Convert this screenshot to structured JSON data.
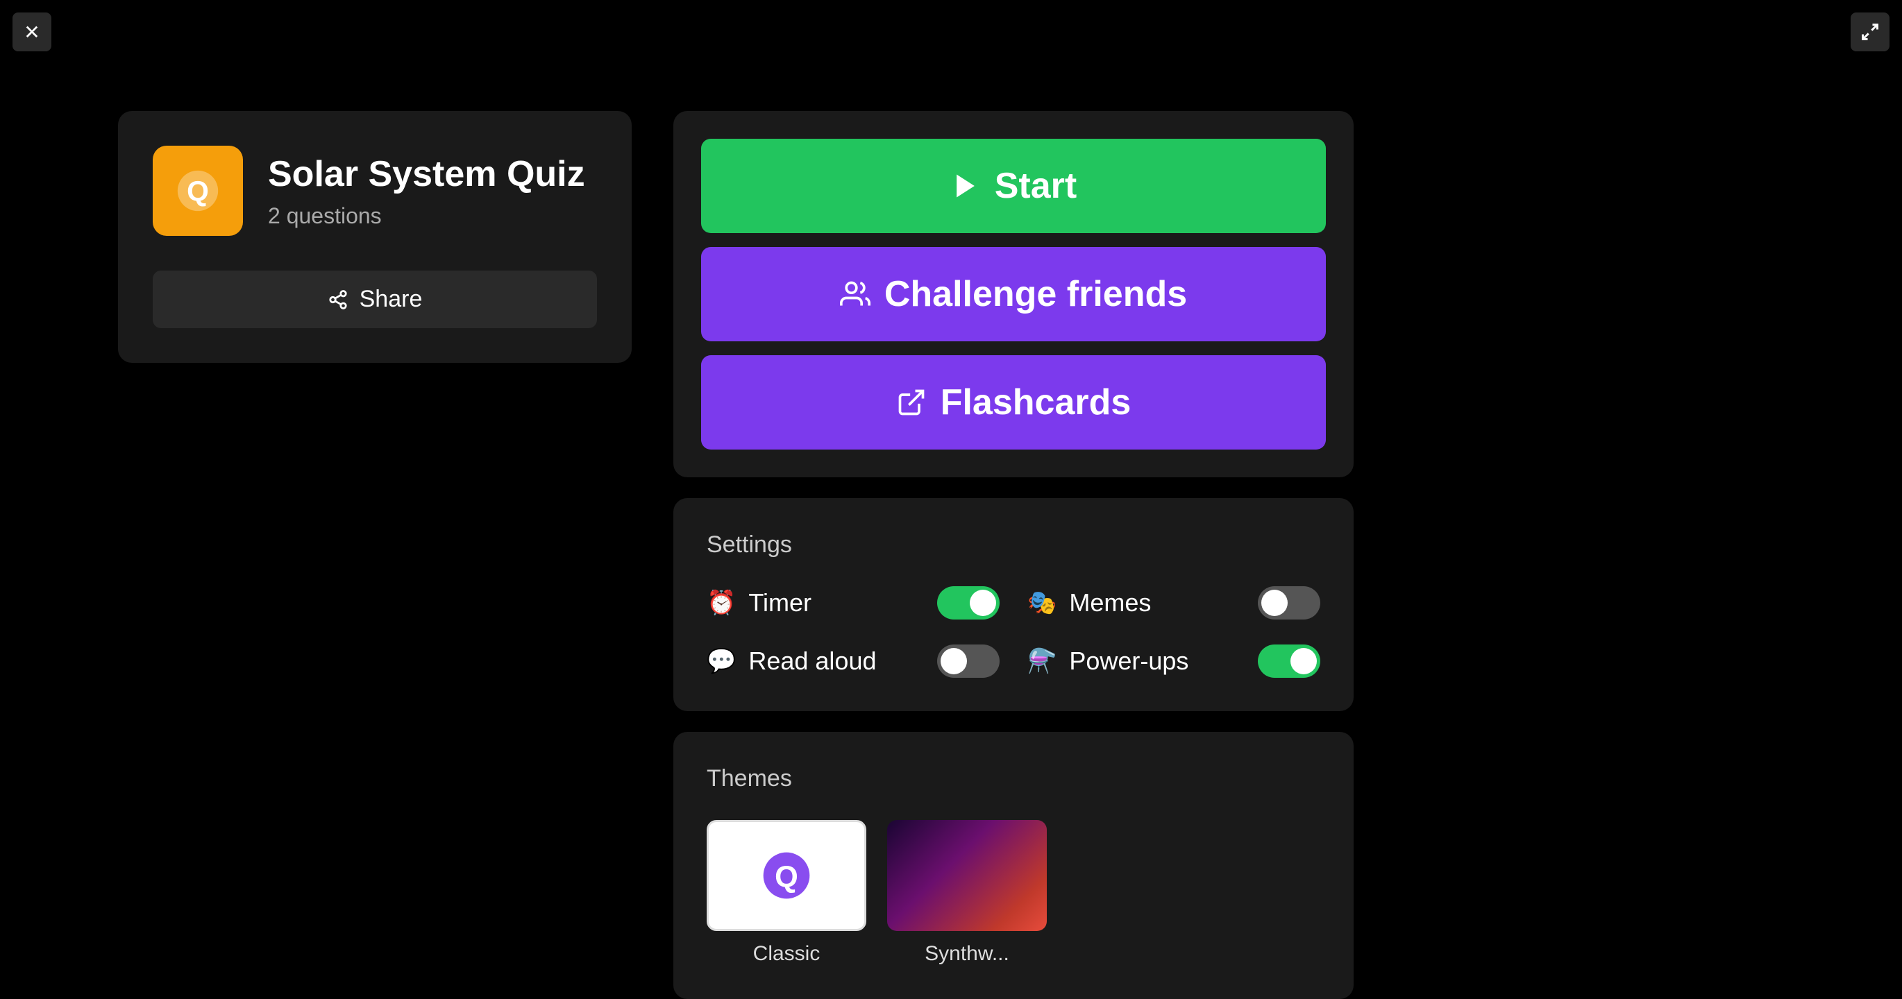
{
  "window": {
    "close_label": "✕",
    "fullscreen_label": "⛶"
  },
  "quiz_card": {
    "title": "Solar System Quiz",
    "questions_count": "2 questions",
    "share_label": "Share",
    "icon_symbol": "Q"
  },
  "action_panel": {
    "start_label": "Start",
    "challenge_label": "Challenge friends",
    "flashcards_label": "Flashcards"
  },
  "settings": {
    "title": "Settings",
    "items": [
      {
        "id": "timer",
        "label": "Timer",
        "icon": "⏰",
        "on": true
      },
      {
        "id": "memes",
        "label": "Memes",
        "icon": "🎭",
        "on": false
      },
      {
        "id": "read_aloud",
        "label": "Read aloud",
        "icon": "💬",
        "on": false
      },
      {
        "id": "power_ups",
        "label": "Power-ups",
        "icon": "⚗",
        "on": true
      }
    ]
  },
  "themes": {
    "title": "Themes",
    "items": [
      {
        "id": "classic",
        "label": "Classic"
      },
      {
        "id": "synthwave",
        "label": "Synthw..."
      }
    ]
  },
  "colors": {
    "green": "#22c55e",
    "purple": "#7c3aed",
    "orange": "#f59e0b"
  }
}
